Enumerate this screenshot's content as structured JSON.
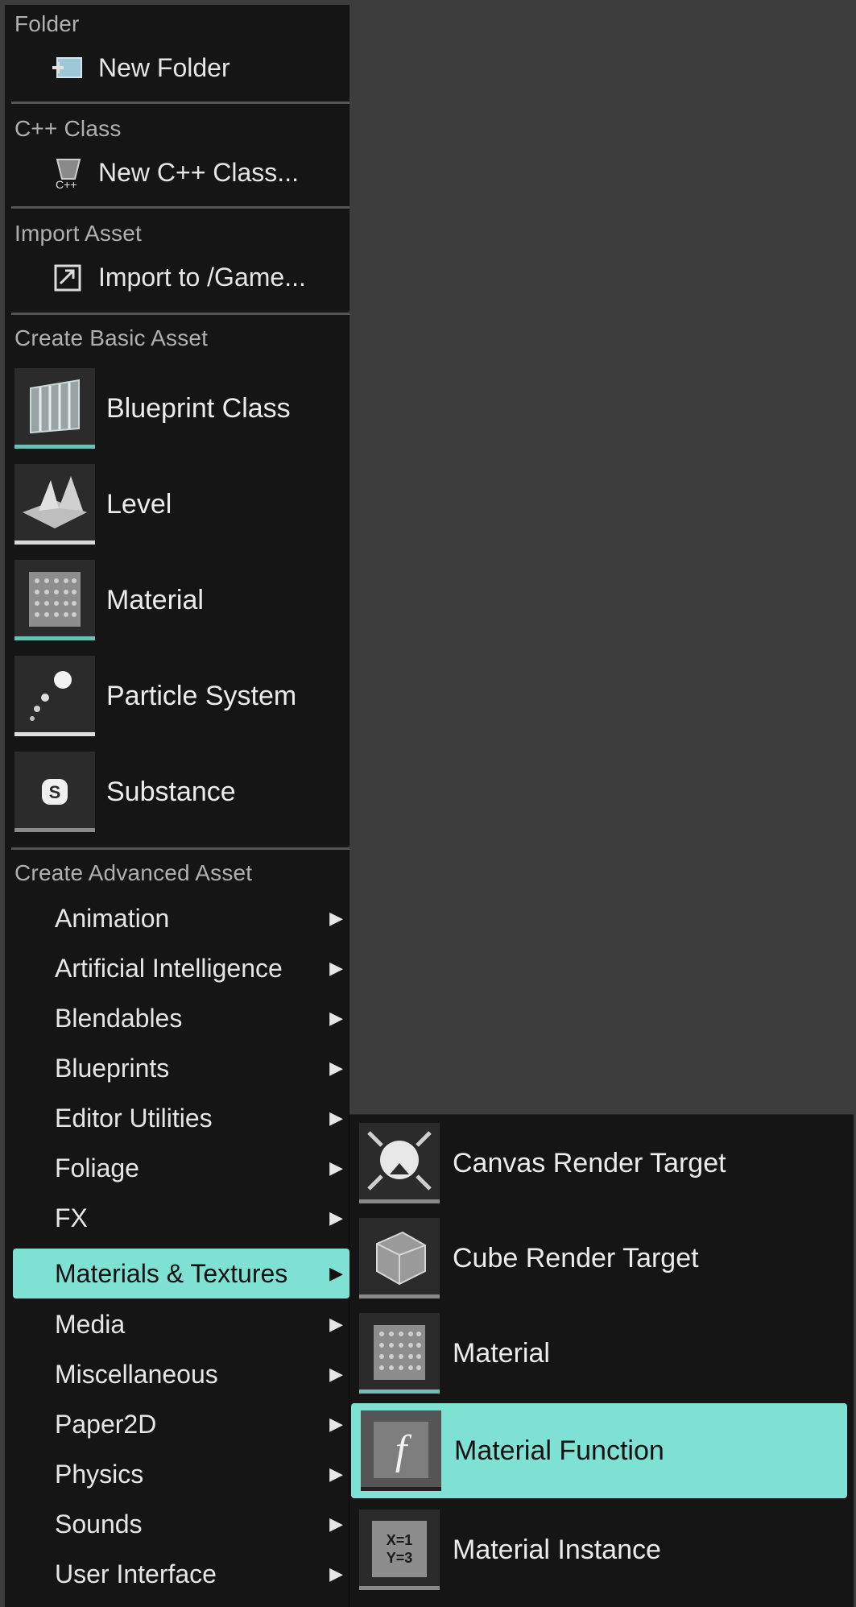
{
  "sections": {
    "folder": {
      "title": "Folder",
      "item": "New Folder",
      "icon": "new-folder-icon"
    },
    "cpp": {
      "title": "C++ Class",
      "item": "New C++ Class...",
      "icon": "cpp-class-icon"
    },
    "import": {
      "title": "Import Asset",
      "item": "Import to /Game...",
      "icon": "import-icon"
    },
    "basic": {
      "title": "Create Basic Asset",
      "items": [
        {
          "label": "Blueprint Class",
          "icon": "blueprint-class-icon"
        },
        {
          "label": "Level",
          "icon": "level-icon"
        },
        {
          "label": "Material",
          "icon": "material-icon"
        },
        {
          "label": "Particle System",
          "icon": "particle-system-icon"
        },
        {
          "label": "Substance",
          "icon": "substance-icon"
        }
      ]
    },
    "advanced": {
      "title": "Create Advanced Asset",
      "items": [
        {
          "label": "Animation"
        },
        {
          "label": "Artificial Intelligence"
        },
        {
          "label": "Blendables"
        },
        {
          "label": "Blueprints"
        },
        {
          "label": "Editor Utilities"
        },
        {
          "label": "Foliage"
        },
        {
          "label": "FX"
        },
        {
          "label": "Materials & Textures",
          "active": true
        },
        {
          "label": "Media"
        },
        {
          "label": "Miscellaneous"
        },
        {
          "label": "Paper2D"
        },
        {
          "label": "Physics"
        },
        {
          "label": "Sounds"
        },
        {
          "label": "User Interface"
        }
      ]
    }
  },
  "submenu": {
    "items": [
      {
        "label": "Canvas Render Target",
        "icon": "canvas-render-target-icon"
      },
      {
        "label": "Cube Render Target",
        "icon": "cube-render-target-icon"
      },
      {
        "label": "Material",
        "icon": "material-icon"
      },
      {
        "label": "Material Function",
        "icon": "material-function-icon",
        "active": true
      },
      {
        "label": "Material Instance",
        "icon": "material-instance-icon",
        "icon_text": "X=1 Y=3"
      }
    ]
  },
  "colors": {
    "highlight": "#7fe0d4",
    "menu_bg": "#151515",
    "backdrop": "#3d3d3d"
  }
}
